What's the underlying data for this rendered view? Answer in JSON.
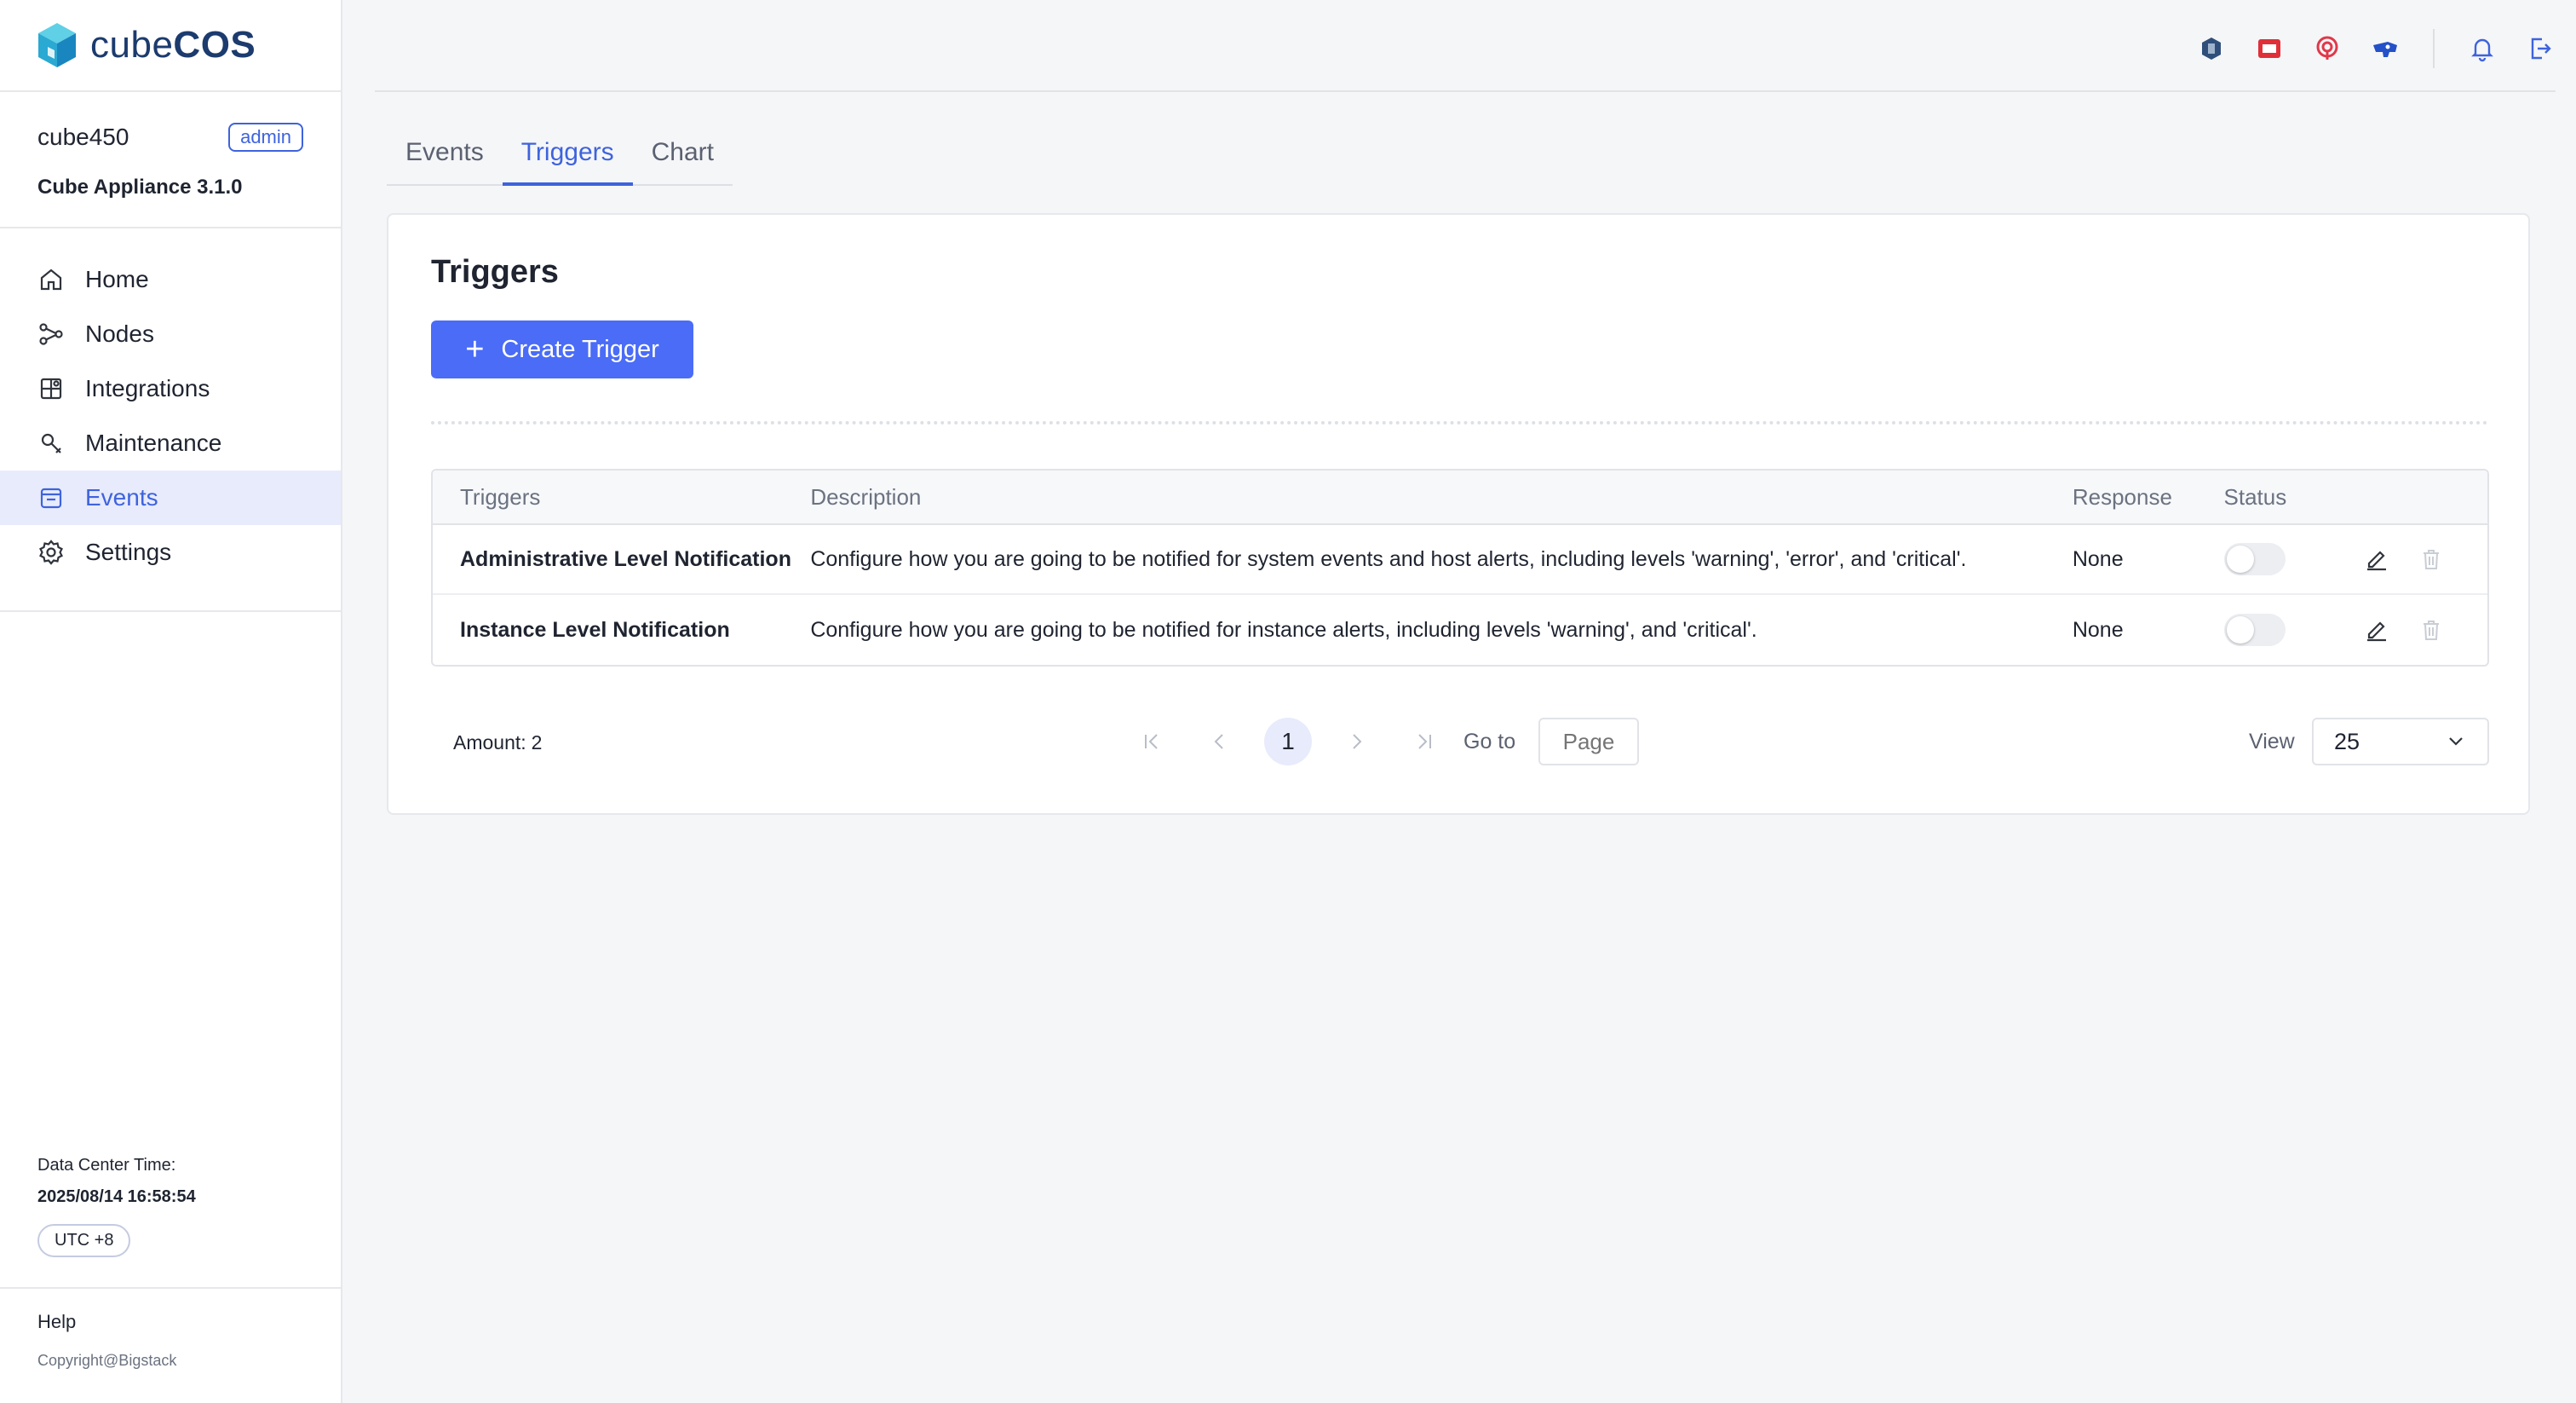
{
  "brand": {
    "prefix": "cube",
    "suffix": "COS"
  },
  "account": {
    "username": "cube450",
    "role": "admin",
    "version": "Cube Appliance 3.1.0"
  },
  "nav": {
    "items": [
      {
        "label": "Home",
        "icon": "home-icon"
      },
      {
        "label": "Nodes",
        "icon": "nodes-icon"
      },
      {
        "label": "Integrations",
        "icon": "integrations-icon"
      },
      {
        "label": "Maintenance",
        "icon": "wrench-icon"
      },
      {
        "label": "Events",
        "icon": "events-icon",
        "active": true
      },
      {
        "label": "Settings",
        "icon": "gear-icon"
      }
    ]
  },
  "datacenter": {
    "label": "Data Center Time:",
    "time": "2025/08/14 16:58:54",
    "timezone": "UTC +8"
  },
  "footer": {
    "help": "Help",
    "copyright": "Copyright@Bigstack"
  },
  "topbar": {
    "icons": [
      "openstack-icon",
      "openshift-icon",
      "ceph-icon",
      "kubernetes-icon",
      "bell-icon",
      "logout-icon"
    ]
  },
  "tabs": [
    {
      "label": "Events"
    },
    {
      "label": "Triggers",
      "active": true
    },
    {
      "label": "Chart"
    }
  ],
  "triggers": {
    "title": "Triggers",
    "create_label": "Create Trigger",
    "columns": {
      "triggers": "Triggers",
      "description": "Description",
      "response": "Response",
      "status": "Status"
    },
    "rows": [
      {
        "name": "Administrative Level Notification",
        "description": "Configure how you are going to be notified for system events and host alerts, including levels 'warning', 'error', and 'critical'.",
        "response": "None",
        "enabled": false
      },
      {
        "name": "Instance Level Notification",
        "description": "Configure how you are going to be notified for instance alerts, including levels 'warning', and 'critical'.",
        "response": "None",
        "enabled": false
      }
    ]
  },
  "pagination": {
    "amount_label": "Amount:",
    "amount": "2",
    "current_page": "1",
    "goto_label": "Go to",
    "page_placeholder": "Page",
    "view_label": "View",
    "page_size": "25"
  },
  "colors": {
    "accent": "#4a6cf7",
    "active_text": "#3e63dd",
    "active_bg": "#e8ebfb"
  }
}
